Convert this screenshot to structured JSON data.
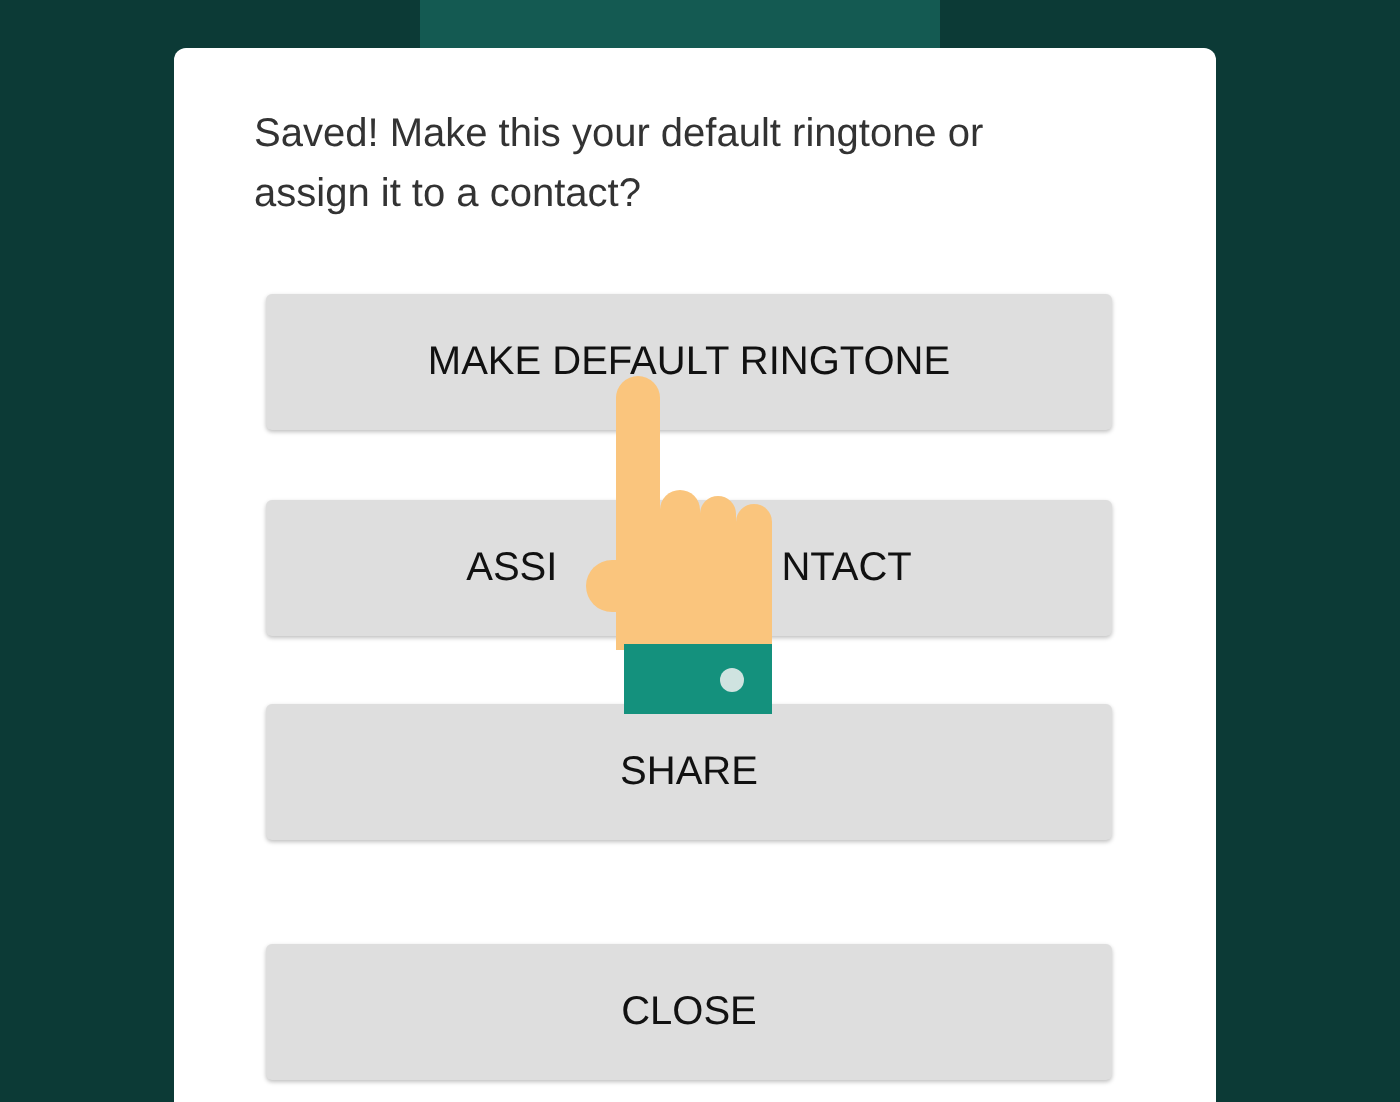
{
  "dialog": {
    "message": "Saved! Make this your default ringtone or assign it to a contact?",
    "buttons": [
      {
        "text_parts": [
          "MAKE DEFAULT RINGTONE"
        ]
      },
      {
        "text_parts": [
          "ASSI",
          "NTACT"
        ]
      },
      {
        "text_parts": [
          "SHARE"
        ]
      },
      {
        "text_parts": [
          "CLOSE"
        ]
      }
    ]
  }
}
